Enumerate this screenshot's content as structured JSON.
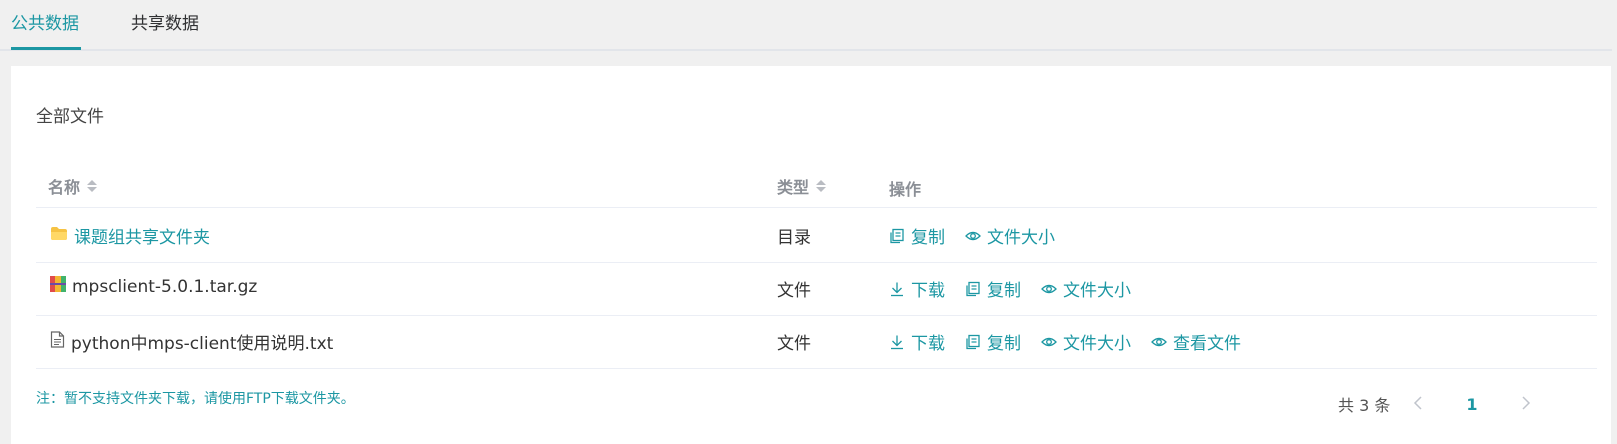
{
  "tabs": [
    {
      "label": "公共数据",
      "active": true
    },
    {
      "label": "共享数据",
      "active": false
    }
  ],
  "section_title": "全部文件",
  "table": {
    "headers": {
      "name": "名称",
      "type": "类型",
      "ops": "操作"
    },
    "rows": [
      {
        "name": "课题组共享文件夹",
        "icon": "folder-icon",
        "type": "目录",
        "ops": [
          "复制",
          "文件大小"
        ]
      },
      {
        "name": "mpsclient-5.0.1.tar.gz",
        "icon": "archive-icon",
        "type": "文件",
        "ops": [
          "下载",
          "复制",
          "文件大小"
        ]
      },
      {
        "name": "python中mps-client使用说明.txt",
        "icon": "text-file-icon",
        "type": "文件",
        "ops": [
          "下载",
          "复制",
          "文件大小",
          "查看文件"
        ]
      }
    ]
  },
  "note": "注：暂不支持文件夹下载，请使用FTP下载文件夹。",
  "pager": {
    "total": "共 3 条",
    "current": "1"
  },
  "colors": {
    "accent": "#1c97a3",
    "background": "#f0f0f0",
    "panel": "#ffffff"
  }
}
